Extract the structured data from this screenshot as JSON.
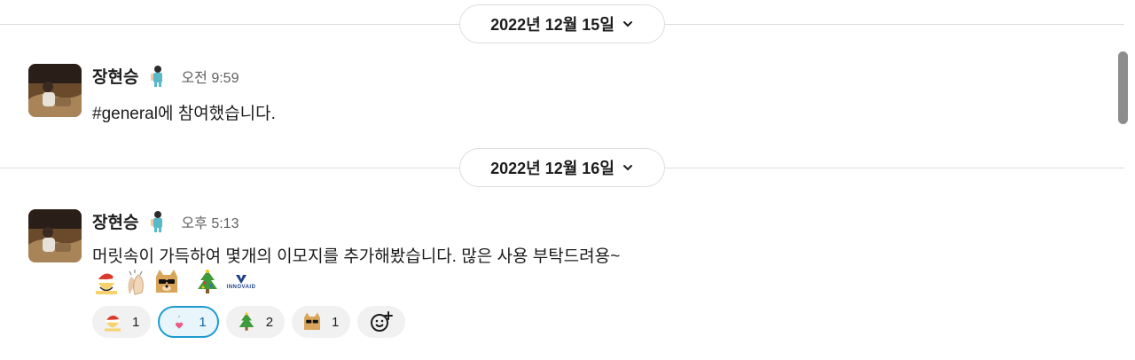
{
  "dates": [
    {
      "label": "2022년 12월 15일"
    },
    {
      "label": "2022년 12월 16일"
    }
  ],
  "messages": [
    {
      "author": "장현승",
      "time": "오전 9:59",
      "text": "#general에 참여했습니다."
    },
    {
      "author": "장현승",
      "time": "오후 5:13",
      "text": "머릿속이 가득하여 몇개의 이모지를 추가해봤습니다. 많은 사용 부탁드려용~"
    }
  ],
  "inline_emojis": [
    "santa-cry-emoji",
    "clapping-hands-emoji",
    "doge-sunglasses-emoji",
    "christmas-tree-emoji",
    "innovaid-logo-emoji"
  ],
  "innovaid_text": "INNOVAID",
  "reactions": [
    {
      "icon": "santa-cry-emoji",
      "count": "1",
      "active": false
    },
    {
      "icon": "heart-sparkle-emoji",
      "count": "1",
      "active": true
    },
    {
      "icon": "christmas-tree-emoji",
      "count": "2",
      "active": false
    },
    {
      "icon": "doge-sunglasses-emoji",
      "count": "1",
      "active": false
    }
  ],
  "colors": {
    "accent": "#1d9bd1",
    "active_bg": "#e8f5fa",
    "text": "#1d1c1d",
    "muted": "#616061"
  }
}
